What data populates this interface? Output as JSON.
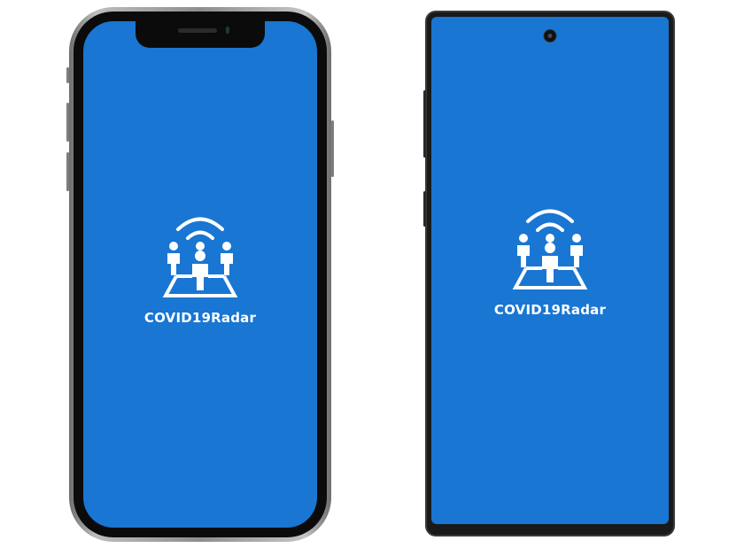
{
  "app": {
    "name": "COVID19Radar",
    "logo_icon": "people-radar-icon"
  },
  "devices": [
    {
      "name": "iPhone",
      "screen_text": "COVID19Radar"
    },
    {
      "name": "Android",
      "screen_text": "COVID19Radar"
    }
  ],
  "colors": {
    "splash_background": "#1976d2",
    "text": "#ffffff"
  }
}
